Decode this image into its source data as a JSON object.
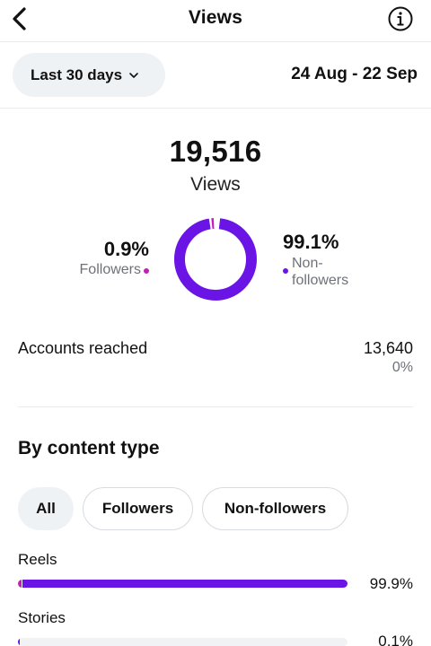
{
  "header": {
    "title": "Views",
    "back_icon": "chevron-left-icon",
    "info_icon": "info-circle-icon"
  },
  "filter": {
    "range_label": "Last 30 days",
    "date_range": "24 Aug - 22 Sep"
  },
  "summary": {
    "total": "19,516",
    "total_label": "Views",
    "followers_pct_text": "0.9%",
    "followers_label": "Followers",
    "non_followers_pct_text": "99.1%",
    "non_followers_label": "Non-\nfollowers",
    "followers_share": 0.009,
    "non_followers_share": 0.991
  },
  "reach": {
    "label": "Accounts reached",
    "value": "13,640",
    "change": "0%"
  },
  "content_type": {
    "title": "By content type",
    "tabs": [
      "All",
      "Followers",
      "Non-followers"
    ],
    "selected_tab": "All",
    "rows": [
      {
        "label": "Reels",
        "pct_text": "99.9%",
        "followers_share": 0.009,
        "non_followers_share": 0.99
      },
      {
        "label": "Stories",
        "pct_text": "0.1%",
        "followers_share": 0.0,
        "non_followers_share": 0.001
      }
    ]
  },
  "colors": {
    "followers": "#c41fb5",
    "non_followers": "#6a14e6",
    "track": "#f1f2f4"
  }
}
